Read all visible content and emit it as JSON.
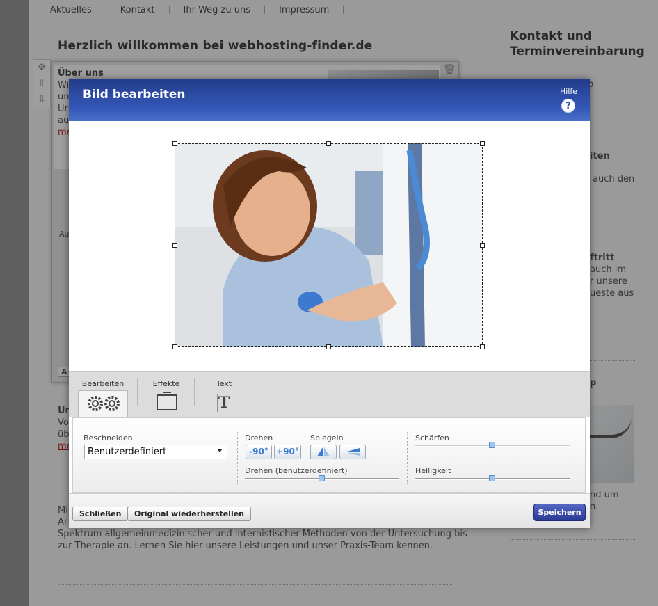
{
  "nav": {
    "items": [
      "Aktuelles",
      "Kontakt",
      "Ihr Weg zu uns",
      "Impressum"
    ]
  },
  "page": {
    "welcome_title": "Herzlich willkommen bei webhosting-finder.de",
    "ueber_uns": "Über uns",
    "frag_wi": "Wi",
    "frag_un": "un",
    "frag_ur": "Ur",
    "frag_au": "au",
    "frag_me": "me",
    "frag_au2": "Au",
    "frag_a": "A",
    "frag_un2": "Un",
    "frag_vo": "Vo",
    "frag_ub": "üb",
    "frag_me2": "me",
    "frag_mi": "Mi",
    "frag_ar": "Ar",
    "bottom_line1": "Spektrum allgemeinmedizinischer und internistischer Methoden von der Untersuchung bis",
    "bottom_line2": "zur Therapie an. Lernen Sie hier unsere Leistungen und unser Praxis-Team kennen."
  },
  "right_col": {
    "title_line1": "Kontakt und",
    "title_line2": "Terminvereinbarung",
    "frag_p": "p",
    "frag_iten": "iten",
    "frag_auch_den": "auch den",
    "frag_ftritt": "ftritt",
    "frag_auch_im": "auch im",
    "frag_r_unsere": "r unsere",
    "frag_ueste_aus": "ueste aus",
    "frag_paren": "p",
    "frag_nd_um": "nd um",
    "frag_n": "n."
  },
  "modal": {
    "title": "Bild bearbeiten",
    "help_label": "Hilfe",
    "help_icon": "?",
    "tabs": [
      {
        "label": "Bearbeiten",
        "icon": "gears-icon"
      },
      {
        "label": "Effekte",
        "icon": "frame-icon"
      },
      {
        "label": "Text",
        "icon": "text-icon"
      }
    ],
    "crop_label": "Beschneiden",
    "crop_value": "Benutzerdefiniert",
    "rotate_label": "Drehen",
    "rotate_minus": "-90°",
    "rotate_plus": "+90°",
    "mirror_label": "Spiegeln",
    "rotate_custom_label": "Drehen (benutzerdefiniert)",
    "rotate_custom_level": 0.5,
    "sharpen_label": "Schärfen",
    "sharpen_level": 0.5,
    "brightness_label": "Helligkeit",
    "brightness_level": 0.5,
    "close_button": "Schließen",
    "restore_button": "Original wiederherstellen",
    "save_button": "Speichern"
  },
  "colors": {
    "header_blue": "#2b4ea5",
    "save_blue": "#3a4aa8",
    "link_red": "#aa0000"
  }
}
